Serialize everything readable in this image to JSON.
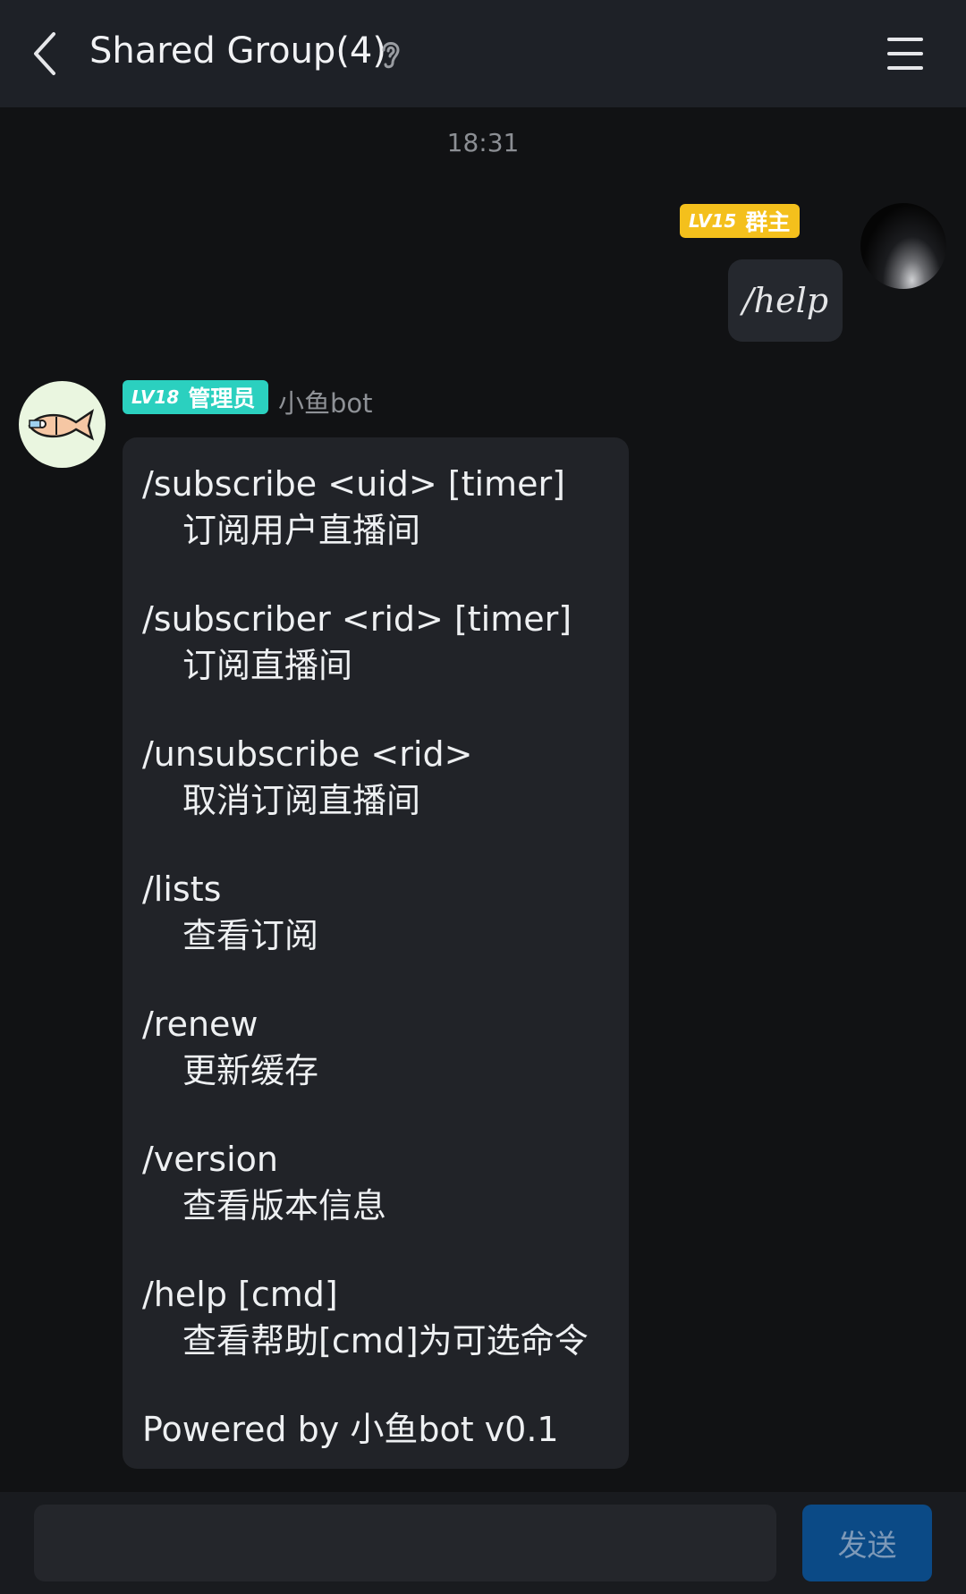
{
  "header": {
    "title": "Shared Group(4)",
    "back_icon": "chevron-left-icon",
    "ear_icon": "ear-icon",
    "menu_icon": "hamburger-menu-icon"
  },
  "timestamp": "18:31",
  "my_message": {
    "badge_level": "LV15",
    "badge_role": "群主",
    "badge_color": "#f4c01c",
    "text": "/help"
  },
  "bot_message": {
    "badge_level": "LV18",
    "badge_role": "管理员",
    "badge_color": "#2bd0bf",
    "sender": "小鱼bot",
    "commands": [
      {
        "cmd": "/subscribe <uid> [timer]",
        "desc": "订阅用户直播间"
      },
      {
        "cmd": "/subscriber <rid> [timer]",
        "desc": "订阅直播间"
      },
      {
        "cmd": "/unsubscribe <rid>",
        "desc": "取消订阅直播间"
      },
      {
        "cmd": "/lists",
        "desc": "查看订阅"
      },
      {
        "cmd": "/renew",
        "desc": "更新缓存"
      },
      {
        "cmd": "/version",
        "desc": "查看版本信息"
      },
      {
        "cmd": "/help [cmd]",
        "desc": "查看帮助[cmd]为可选命令"
      }
    ],
    "footer": "Powered by 小鱼bot v0.1"
  },
  "input": {
    "value": "",
    "send_label": "发送",
    "send_color": "#0b4a86"
  }
}
